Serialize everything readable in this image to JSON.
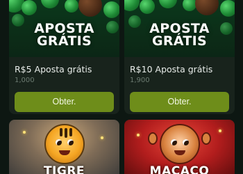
{
  "bonus_cards": [
    {
      "banner_line1": "APOSTA",
      "banner_line2": "GRÁTIS",
      "title": "R$5 Aposta grátis",
      "subtitle": "1,000",
      "button_label": "Obter."
    },
    {
      "banner_line1": "APOSTA",
      "banner_line2": "GRÁTIS",
      "title": "R$10 Aposta grátis",
      "subtitle": "1,900",
      "button_label": "Obter."
    }
  ],
  "game_cards": [
    {
      "label": "TIGRE"
    },
    {
      "label": "MACACO"
    }
  ],
  "colors": {
    "background": "#0d1712",
    "card": "#18231c",
    "button": "#6e8d1a",
    "subtitle": "#6c7b71"
  }
}
